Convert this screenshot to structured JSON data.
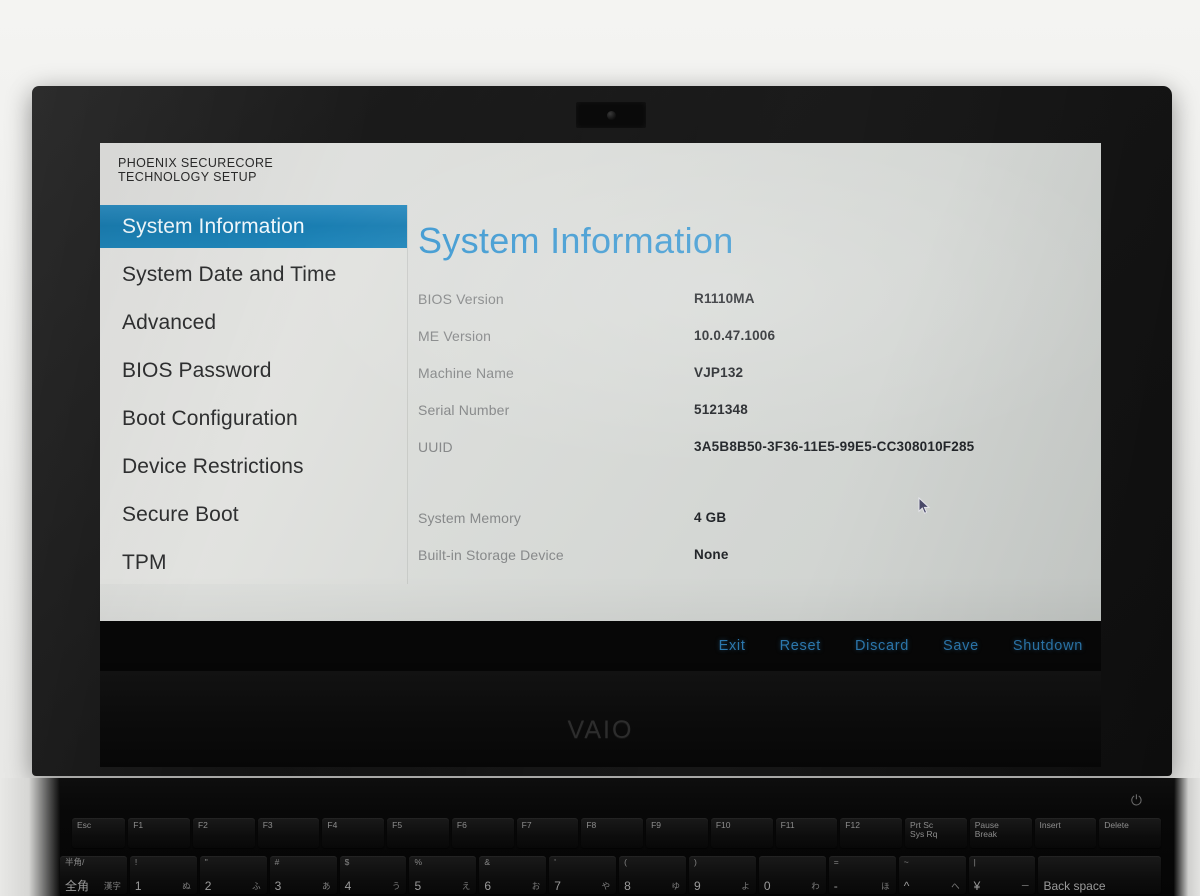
{
  "device": {
    "brand_logo": "VAIO",
    "power_icon": "power-icon",
    "webcam": "webcam-lens"
  },
  "bios": {
    "header_title": "PHOENIX SECURECORE\nTECHNOLOGY SETUP",
    "sidebar": {
      "items": [
        {
          "label": "System Information",
          "selected": true
        },
        {
          "label": "System Date and Time",
          "selected": false
        },
        {
          "label": "Advanced",
          "selected": false
        },
        {
          "label": "BIOS Password",
          "selected": false
        },
        {
          "label": "Boot Configuration",
          "selected": false
        },
        {
          "label": "Device Restrictions",
          "selected": false
        },
        {
          "label": "Secure Boot",
          "selected": false
        },
        {
          "label": "TPM",
          "selected": false
        }
      ]
    },
    "content": {
      "title": "System Information",
      "rows": [
        {
          "label": "BIOS Version",
          "value": "R1110MA"
        },
        {
          "label": "ME Version",
          "value": "10.0.47.1006"
        },
        {
          "label": "Machine Name",
          "value": "VJP132"
        },
        {
          "label": "Serial Number",
          "value": "5121348"
        },
        {
          "label": "UUID",
          "value": "3A5B8B50-3F36-11E5-99E5-CC308010F285"
        }
      ],
      "rows2": [
        {
          "label": "System Memory",
          "value": "4 GB"
        },
        {
          "label": "Built-in Storage Device",
          "value": "None"
        }
      ]
    },
    "actions": [
      {
        "label": "Exit"
      },
      {
        "label": "Reset"
      },
      {
        "label": "Discard"
      },
      {
        "label": "Save"
      },
      {
        "label": "Shutdown"
      }
    ],
    "colors": {
      "selected_blue": "#1f86ba",
      "title_blue": "#3f9ad2",
      "action_blue": "#2f7fb8",
      "label_gray": "#87898a",
      "value_dark": "#23262a"
    }
  },
  "keyboard": {
    "function_row": [
      {
        "label": "Esc"
      },
      {
        "label": "F1"
      },
      {
        "label": "F2"
      },
      {
        "label": "F3"
      },
      {
        "label": "F4"
      },
      {
        "label": "F5"
      },
      {
        "label": "F6"
      },
      {
        "label": "F7"
      },
      {
        "label": "F8"
      },
      {
        "label": "F9"
      },
      {
        "label": "F10"
      },
      {
        "label": "F11"
      },
      {
        "label": "F12"
      },
      {
        "label": "Prt Sc\nSys Rq"
      },
      {
        "label": "Pause\nBreak"
      },
      {
        "label": "Insert"
      },
      {
        "label": "Delete"
      }
    ],
    "number_row": [
      {
        "shifted": "半角/",
        "base": "全角",
        "kana": "漢字"
      },
      {
        "shifted": "!",
        "base": "1",
        "kana": "ぬ"
      },
      {
        "shifted": "\"",
        "base": "2",
        "kana": "ふ"
      },
      {
        "shifted": "#",
        "base": "3",
        "kana": "あ"
      },
      {
        "shifted": "$",
        "base": "4",
        "kana": "う"
      },
      {
        "shifted": "%",
        "base": "5",
        "kana": "え"
      },
      {
        "shifted": "&",
        "base": "6",
        "kana": "お"
      },
      {
        "shifted": "'",
        "base": "7",
        "kana": "や"
      },
      {
        "shifted": "(",
        "base": "8",
        "kana": "ゆ"
      },
      {
        "shifted": ")",
        "base": "9",
        "kana": "よ"
      },
      {
        "shifted": "",
        "base": "0",
        "kana": "わ"
      },
      {
        "shifted": "=",
        "base": "-",
        "kana": "ほ"
      },
      {
        "shifted": "~",
        "base": "^",
        "kana": "へ"
      },
      {
        "shifted": "|",
        "base": "¥",
        "kana": "ー"
      },
      {
        "shifted": "",
        "base": "Back space",
        "kana": ""
      }
    ]
  }
}
